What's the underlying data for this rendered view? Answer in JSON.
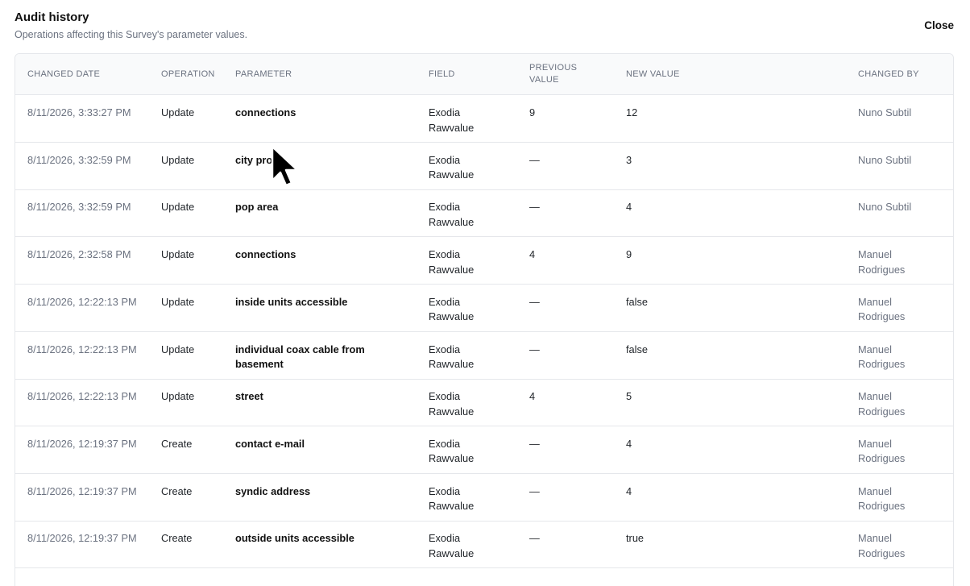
{
  "dialog": {
    "title": "Audit history",
    "subtitle": "Operations affecting this Survey's parameter values.",
    "close_label": "Close"
  },
  "table": {
    "headers": {
      "changed_date": "CHANGED DATE",
      "operation": "OPERATION",
      "parameter": "PARAMETER",
      "field": "FIELD",
      "previous_value_line1": "PREVIOUS",
      "previous_value_line2": "VALUE",
      "new_value": "NEW VALUE",
      "changed_by": "CHANGED BY"
    },
    "rows": [
      {
        "date": "8/11/2026, 3:33:27 PM",
        "operation": "Update",
        "parameter": "connections",
        "field_line1": "Exodia",
        "field_line2": "Rawvalue",
        "previous": "9",
        "new": "12",
        "by_line1": "Nuno Subtil",
        "by_line2": ""
      },
      {
        "date": "8/11/2026, 3:32:59 PM",
        "operation": "Update",
        "parameter": "city pro",
        "field_line1": "Exodia",
        "field_line2": "Rawvalue",
        "previous": "—",
        "new": "3",
        "by_line1": "Nuno Subtil",
        "by_line2": ""
      },
      {
        "date": "8/11/2026, 3:32:59 PM",
        "operation": "Update",
        "parameter": "pop area",
        "field_line1": "Exodia",
        "field_line2": "Rawvalue",
        "previous": "—",
        "new": "4",
        "by_line1": "Nuno Subtil",
        "by_line2": ""
      },
      {
        "date": "8/11/2026, 2:32:58 PM",
        "operation": "Update",
        "parameter": "connections",
        "field_line1": "Exodia",
        "field_line2": "Rawvalue",
        "previous": "4",
        "new": "9",
        "by_line1": "Manuel",
        "by_line2": "Rodrigues"
      },
      {
        "date": "8/11/2026, 12:22:13 PM",
        "operation": "Update",
        "parameter": "inside units accessible",
        "field_line1": "Exodia",
        "field_line2": "Rawvalue",
        "previous": "—",
        "new": "false",
        "by_line1": "Manuel",
        "by_line2": "Rodrigues"
      },
      {
        "date": "8/11/2026, 12:22:13 PM",
        "operation": "Update",
        "parameter": "individual coax cable from basement",
        "field_line1": "Exodia",
        "field_line2": "Rawvalue",
        "previous": "—",
        "new": "false",
        "by_line1": "Manuel",
        "by_line2": "Rodrigues"
      },
      {
        "date": "8/11/2026, 12:22:13 PM",
        "operation": "Update",
        "parameter": "street",
        "field_line1": "Exodia",
        "field_line2": "Rawvalue",
        "previous": "4",
        "new": "5",
        "by_line1": "Manuel",
        "by_line2": "Rodrigues"
      },
      {
        "date": "8/11/2026, 12:19:37 PM",
        "operation": "Create",
        "parameter": "contact e-mail",
        "field_line1": "Exodia",
        "field_line2": "Rawvalue",
        "previous": "—",
        "new": "4",
        "by_line1": "Manuel",
        "by_line2": "Rodrigues"
      },
      {
        "date": "8/11/2026, 12:19:37 PM",
        "operation": "Create",
        "parameter": "syndic address",
        "field_line1": "Exodia",
        "field_line2": "Rawvalue",
        "previous": "—",
        "new": "4",
        "by_line1": "Manuel",
        "by_line2": "Rodrigues"
      },
      {
        "date": "8/11/2026, 12:19:37 PM",
        "operation": "Create",
        "parameter": "outside units accessible",
        "field_line1": "Exodia",
        "field_line2": "Rawvalue",
        "previous": "—",
        "new": "true",
        "by_line1": "Manuel",
        "by_line2": "Rodrigues"
      }
    ]
  },
  "cursor": {
    "icon": "mouse-pointer-icon"
  }
}
